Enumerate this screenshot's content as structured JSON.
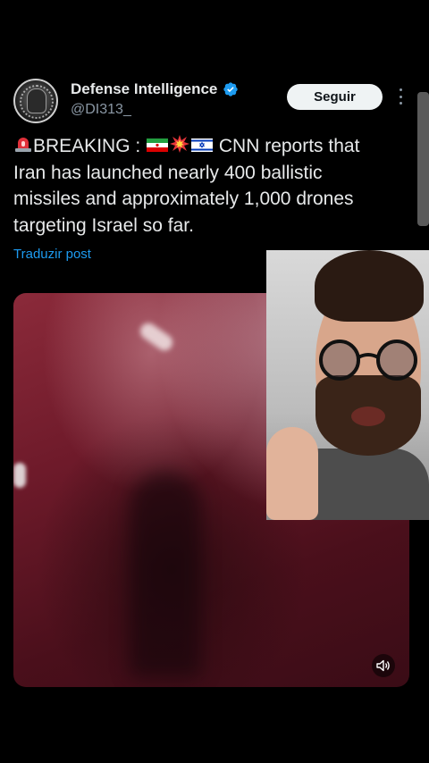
{
  "author": {
    "display_name": "Defense Intelligence",
    "handle": "@DI313_"
  },
  "follow_button": {
    "label": "Seguir"
  },
  "post": {
    "line1_prefix": "BREAKING : ",
    "line1_suffix": " CNN reports that",
    "line2": "Iran has launched nearly 400 ballistic",
    "line3": "missiles and approximately 1,000 drones",
    "line4": "targeting Israel so far.",
    "emojis": [
      "siren-emoji",
      "iran-flag-emoji",
      "explosion-emoji",
      "israel-flag-emoji"
    ]
  },
  "translate_link": "Traduzir post",
  "icons": {
    "verified": "verified-badge-icon",
    "more": "more-vertical-icon",
    "volume": "speaker-icon"
  },
  "colors": {
    "background": "#000000",
    "text": "#e7e9ea",
    "handle": "#8b98a5",
    "link": "#1d9bf0",
    "verified": "#1d9bf0",
    "follow_bg": "#eff3f4"
  }
}
